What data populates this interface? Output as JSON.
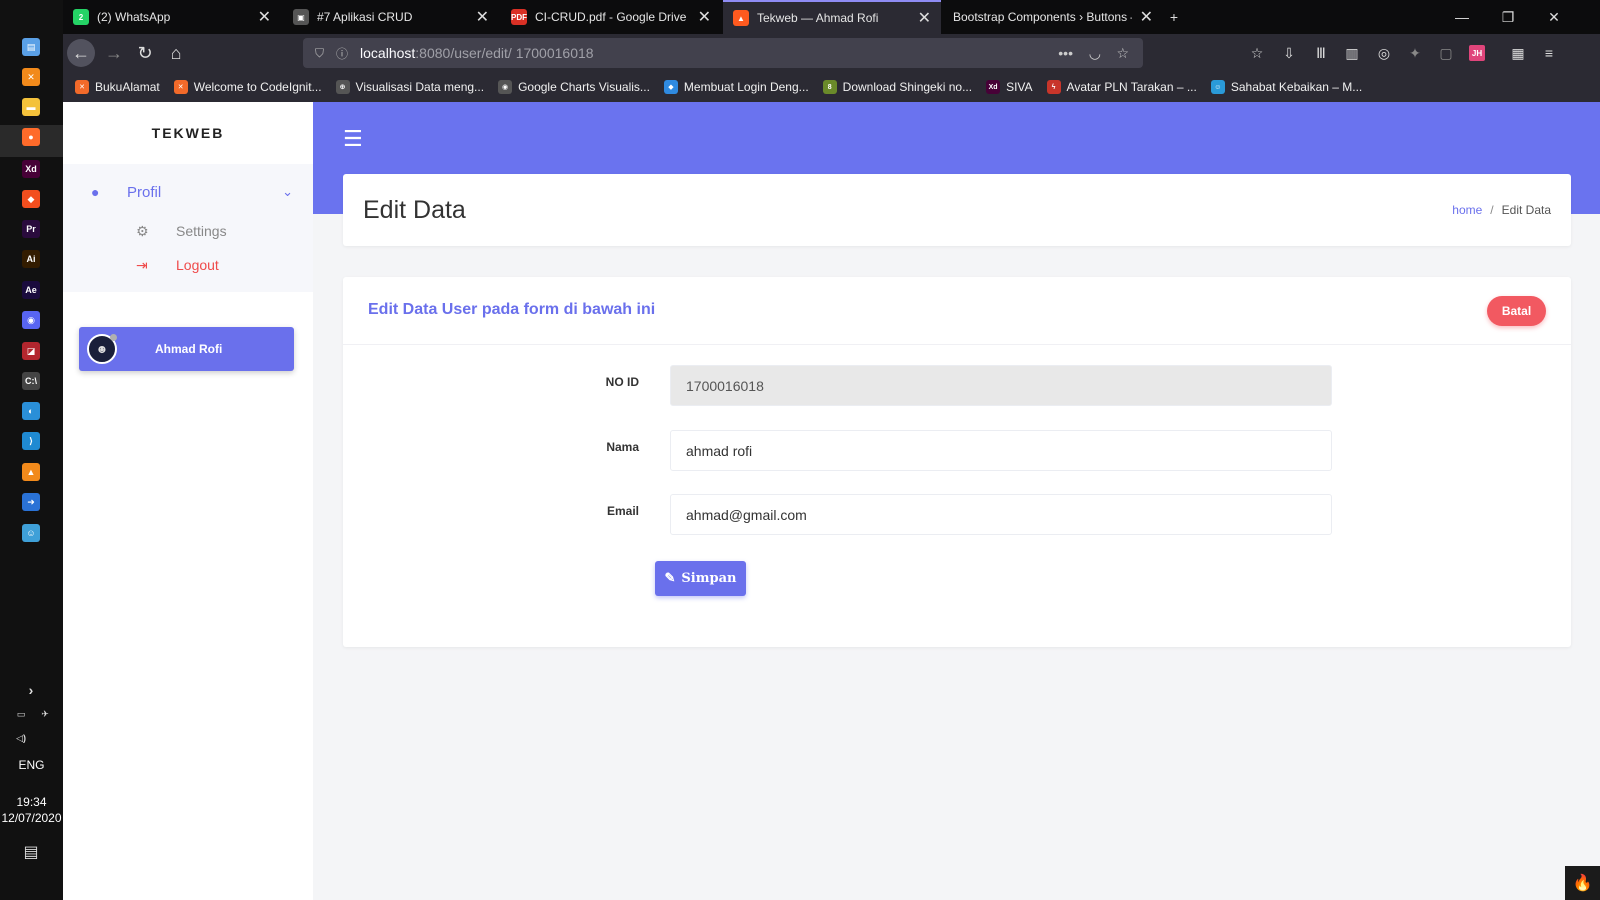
{
  "taskbar": {
    "apps": [
      {
        "name": "explorer",
        "glyph": "▤",
        "color": "#5aa0e6"
      },
      {
        "name": "xampp",
        "glyph": "✕",
        "color": "#f28a1b"
      },
      {
        "name": "files",
        "glyph": "▬",
        "color": "#f4c23b"
      },
      {
        "name": "firefox",
        "glyph": "●",
        "color": "#ff6b2a"
      },
      {
        "name": "adobe-xd",
        "glyph": "Xd",
        "color": "#470137"
      },
      {
        "name": "figma",
        "glyph": "◆",
        "color": "#f24e1e"
      },
      {
        "name": "premiere",
        "glyph": "Pr",
        "color": "#2a0b3d"
      },
      {
        "name": "illustrator",
        "glyph": "Ai",
        "color": "#331c00"
      },
      {
        "name": "after-effects",
        "glyph": "Ae",
        "color": "#1a0b3d"
      },
      {
        "name": "discord",
        "glyph": "◉",
        "color": "#5865f2"
      },
      {
        "name": "app-red",
        "glyph": "◪",
        "color": "#b3262e"
      },
      {
        "name": "terminal",
        "glyph": "C:\\",
        "color": "#444"
      },
      {
        "name": "edge",
        "glyph": "◐",
        "color": "#2a8fd8"
      },
      {
        "name": "vscode",
        "glyph": "⟩",
        "color": "#1f8ad2"
      },
      {
        "name": "vlc",
        "glyph": "▲",
        "color": "#f28a1b"
      },
      {
        "name": "app-blue",
        "glyph": "➜",
        "color": "#2a72d6"
      },
      {
        "name": "app-robot",
        "glyph": "☺",
        "color": "#3fa0d8"
      }
    ],
    "language": "ENG",
    "time": "19:34",
    "date": "12/07/2020"
  },
  "browser": {
    "tabs": [
      {
        "title": "(2) WhatsApp",
        "badge": "2",
        "color": "#25d366",
        "active": false
      },
      {
        "title": "#7 Aplikasi CRUD",
        "badge": "▣",
        "color": "#555",
        "active": false
      },
      {
        "title": "CI-CRUD.pdf - Google Drive",
        "badge": "PDF",
        "color": "#d93025",
        "active": false
      },
      {
        "title": "Tekweb — Ahmad Rofi",
        "badge": "▲",
        "color": "#ff5a1f",
        "active": true
      },
      {
        "title": "Bootstrap Components › Buttons –",
        "badge": "",
        "color": "",
        "active": false
      }
    ],
    "new_tab": "+",
    "url_host": "localhost",
    "url_path": ":8080/user/edit/ 1700016018",
    "bookmarks": [
      {
        "title": "BukuAlamat",
        "glyph": "✕",
        "color": "#f26a2a"
      },
      {
        "title": "Welcome to CodeIgnit...",
        "glyph": "✕",
        "color": "#f26a2a"
      },
      {
        "title": "Visualisasi Data meng...",
        "glyph": "⊕",
        "color": "#555"
      },
      {
        "title": "Google Charts Visualis...",
        "glyph": "◉",
        "color": "#555"
      },
      {
        "title": "Membuat Login Deng...",
        "glyph": "◆",
        "color": "#2f8ae0"
      },
      {
        "title": "Download Shingeki no...",
        "glyph": "8",
        "color": "#6a8a2a"
      },
      {
        "title": "SIVA",
        "glyph": "Xd",
        "color": "#470137"
      },
      {
        "title": "Avatar PLN Tarakan – ...",
        "glyph": "ϟ",
        "color": "#c8352a"
      },
      {
        "title": "Sahabat Kebaikan – M...",
        "glyph": "☺",
        "color": "#2a9ad8"
      }
    ]
  },
  "app": {
    "brand": "TEKWEB",
    "menu": {
      "profil": "Profil",
      "settings": "Settings",
      "logout": "Logout"
    },
    "user_name": "Ahmad Rofi",
    "page_title": "Edit Data",
    "breadcrumb": {
      "home": "home",
      "sep": "/",
      "current": "Edit Data"
    },
    "form": {
      "heading": "Edit Data User pada form di bawah ini",
      "cancel_label": "Batal",
      "fields": {
        "id": {
          "label": "NO ID",
          "value": "1700016018"
        },
        "name": {
          "label": "Nama",
          "value": "ahmad rofi"
        },
        "email": {
          "label": "Email",
          "value": "ahmad@gmail.com"
        }
      },
      "save_label": "Simpan"
    }
  }
}
